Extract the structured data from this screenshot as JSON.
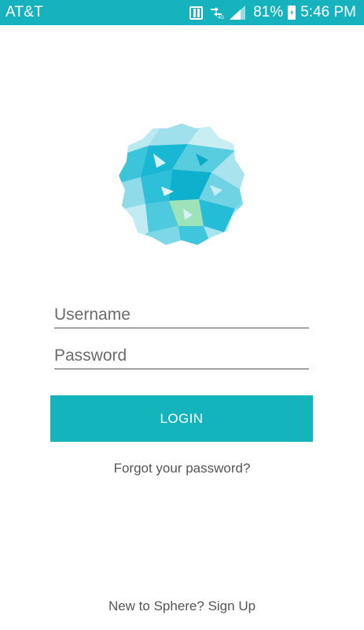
{
  "status_bar": {
    "carrier": "AT&T",
    "battery_percent": "81%",
    "time": "5:46 PM",
    "icons": [
      "nfc-icon",
      "data-sync-icon",
      "signal-icon",
      "battery-charging-icon"
    ],
    "color": "#16b3be"
  },
  "logo": {
    "icon": "sphere-logo-icon"
  },
  "login_form": {
    "username_placeholder": "Username",
    "password_placeholder": "Password",
    "login_label": "LOGIN",
    "forgot_password_label": "Forgot your password?"
  },
  "footer": {
    "signup_label": "New to Sphere? Sign Up"
  },
  "colors": {
    "accent": "#14b4bd",
    "text_muted": "#555555"
  }
}
